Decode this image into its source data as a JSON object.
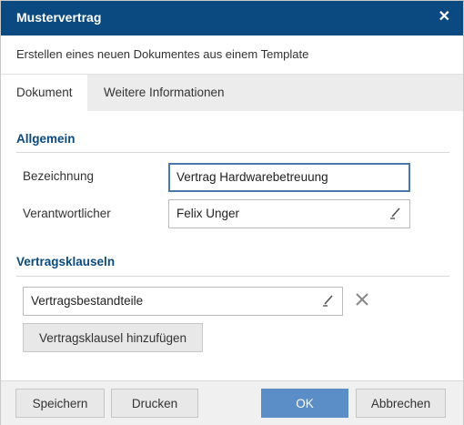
{
  "dialog": {
    "title": "Mustervertrag",
    "subtitle": "Erstellen eines neuen Dokumentes aus einem Template"
  },
  "tabs": [
    {
      "label": "Dokument",
      "active": true
    },
    {
      "label": "Weitere Informationen",
      "active": false
    }
  ],
  "allgemein": {
    "title": "Allgemein",
    "bezeichnung_label": "Bezeichnung",
    "bezeichnung_value": "Vertrag Hardwarebetreuung",
    "verantwortlicher_label": "Verantwortlicher",
    "verantwortlicher_value": "Felix Unger"
  },
  "klauseln": {
    "title": "Vertragsklauseln",
    "items": [
      {
        "value": "Vertragsbestandteile"
      }
    ],
    "add_label": "Vertragsklausel hinzufügen"
  },
  "footer": {
    "save_label": "Speichern",
    "print_label": "Drucken",
    "ok_label": "OK",
    "cancel_label": "Abbrechen"
  },
  "colors": {
    "titlebar": "#0a4a80",
    "accent": "#0a4a80",
    "primary_button": "#5b8ec6"
  },
  "icons": {
    "close": "close-icon",
    "edit": "pencil-icon",
    "remove": "remove-icon"
  }
}
